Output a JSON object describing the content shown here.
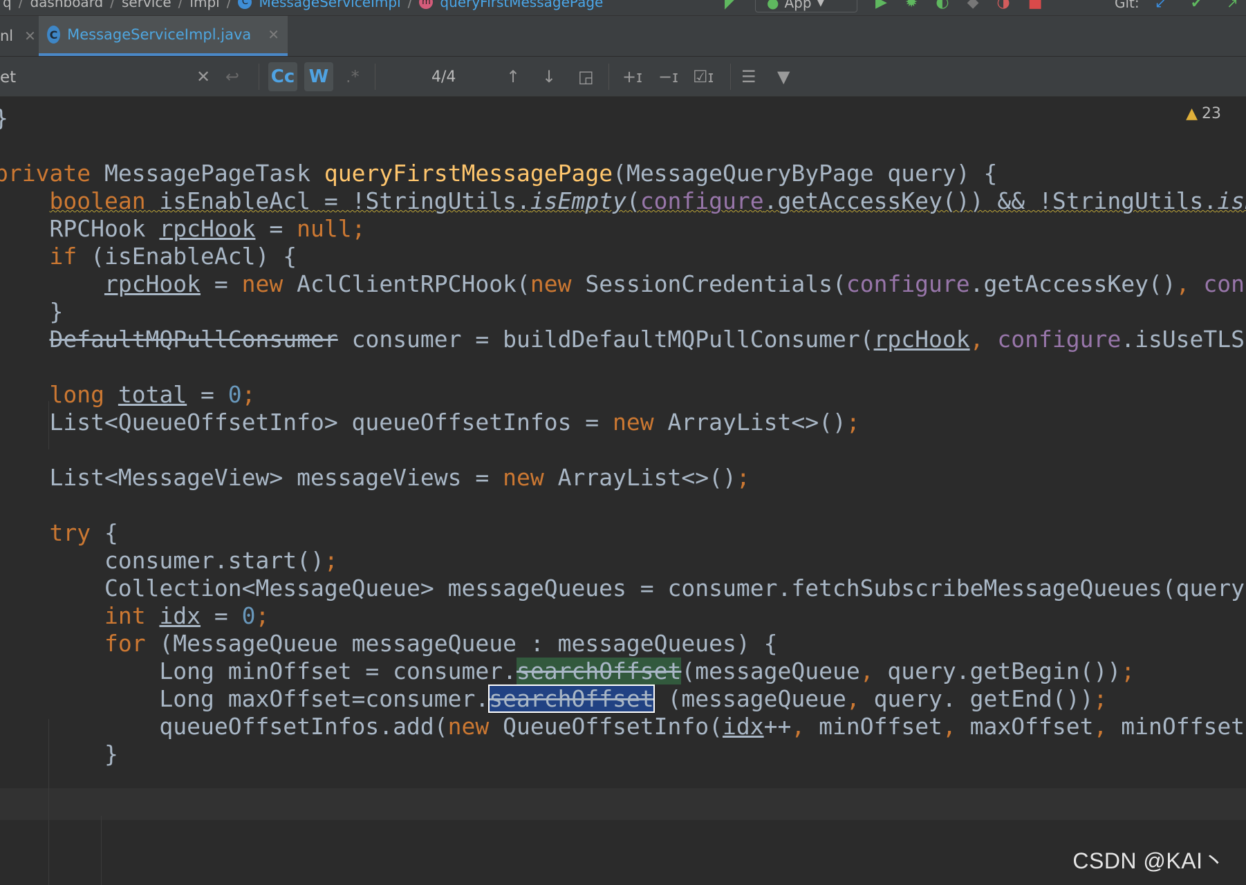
{
  "breadcrumb": {
    "items": [
      "q",
      "dashboard",
      "service",
      "impl"
    ],
    "class_name": "MessageServiceImpl",
    "method_name": "queryFirstMessagePage"
  },
  "toolbar": {
    "run_config": "App",
    "git_label": "Git:"
  },
  "tabs": [
    {
      "label": "nl"
    },
    {
      "label": "MessageServiceImpl.java",
      "icon": "C"
    }
  ],
  "search": {
    "value": "et",
    "match_case_label": "Cc",
    "words_label": "W",
    "regex_label": ".*",
    "match_count": "4/4"
  },
  "editor": {
    "warning_count": "23",
    "watermark": "CSDN @KAI丶",
    "colors": {
      "background": "#2b2b2b",
      "keyword": "#cc7832",
      "method": "#ffc66d",
      "field": "#9876aa",
      "number": "#6897bb",
      "text": "#a9b7c6",
      "search_current": "#214283",
      "search_match": "#32593d"
    },
    "lines": [
      [
        {
          "t": "}"
        }
      ],
      [],
      [
        {
          "t": "private",
          "c": "kw"
        },
        {
          "t": " MessagePageTask "
        },
        {
          "t": "queryFirstMessagePage",
          "c": "fn"
        },
        {
          "t": "(MessageQueryByPage query) {"
        }
      ],
      [
        {
          "t": "    "
        },
        {
          "t": "boolean",
          "c": "kw squig"
        },
        {
          "t": " isEnableAcl = !StringUtils.",
          "c": "squig"
        },
        {
          "t": "isEmpty",
          "c": "it squig"
        },
        {
          "t": "(",
          "c": "squig"
        },
        {
          "t": "configure",
          "c": "fld squig"
        },
        {
          "t": ".getAccessKey()) && !StringUtils.",
          "c": "squig"
        },
        {
          "t": "isEmp",
          "c": "it squig"
        }
      ],
      [
        {
          "t": "    RPCHook "
        },
        {
          "t": "rpcHook",
          "c": "u"
        },
        {
          "t": " = "
        },
        {
          "t": "null",
          "c": "kw"
        },
        {
          "t": ";",
          "c": "kw"
        }
      ],
      [
        {
          "t": "    "
        },
        {
          "t": "if",
          "c": "kw"
        },
        {
          "t": " (isEnableAcl) {"
        }
      ],
      [
        {
          "t": "        "
        },
        {
          "t": "rpcHook",
          "c": "u"
        },
        {
          "t": " = "
        },
        {
          "t": "new",
          "c": "kw"
        },
        {
          "t": " AclClientRPCHook("
        },
        {
          "t": "new",
          "c": "kw"
        },
        {
          "t": " SessionCredentials("
        },
        {
          "t": "configure",
          "c": "fld"
        },
        {
          "t": ".getAccessKey()"
        },
        {
          "t": ",",
          "c": "kw"
        },
        {
          "t": " "
        },
        {
          "t": "config",
          "c": "fld"
        }
      ],
      [
        {
          "t": "    }"
        }
      ],
      [
        {
          "t": "    "
        },
        {
          "t": "DefaultMQPullConsumer",
          "c": "strike"
        },
        {
          "t": " consumer = buildDefaultMQPullConsumer("
        },
        {
          "t": "rpcHook",
          "c": "u"
        },
        {
          "t": ",",
          "c": "kw"
        },
        {
          "t": " "
        },
        {
          "t": "configure",
          "c": "fld"
        },
        {
          "t": ".isUseTLS())"
        }
      ],
      [],
      [
        {
          "t": "    "
        },
        {
          "t": "long",
          "c": "kw"
        },
        {
          "t": " "
        },
        {
          "t": "total",
          "c": "u"
        },
        {
          "t": " = "
        },
        {
          "t": "0",
          "c": "num"
        },
        {
          "t": ";",
          "c": "kw"
        }
      ],
      [
        {
          "t": "    List<QueueOffsetInfo> queueOffsetInfos = "
        },
        {
          "t": "new",
          "c": "kw"
        },
        {
          "t": " ArrayList<>()"
        },
        {
          "t": ";",
          "c": "kw"
        }
      ],
      [],
      [
        {
          "t": "    List<MessageView> messageViews = "
        },
        {
          "t": "new",
          "c": "kw"
        },
        {
          "t": " ArrayList<>()"
        },
        {
          "t": ";",
          "c": "kw"
        }
      ],
      [],
      [
        {
          "t": "    "
        },
        {
          "t": "try",
          "c": "kw"
        },
        {
          "t": " {"
        }
      ],
      [
        {
          "t": "        consumer.start()"
        },
        {
          "t": ";",
          "c": "kw"
        }
      ],
      [
        {
          "t": "        Collection<MessageQueue> messageQueues = consumer.fetchSubscribeMessageQueues(query.ge"
        }
      ],
      [
        {
          "t": "        "
        },
        {
          "t": "int",
          "c": "kw"
        },
        {
          "t": " "
        },
        {
          "t": "idx",
          "c": "u"
        },
        {
          "t": " = "
        },
        {
          "t": "0",
          "c": "num"
        },
        {
          "t": ";",
          "c": "kw"
        }
      ],
      [
        {
          "t": "        "
        },
        {
          "t": "for",
          "c": "kw"
        },
        {
          "t": " (MessageQueue messageQueue : messageQueues) {"
        }
      ],
      [
        {
          "t": "            Long minOffset = consumer."
        },
        {
          "t": "searchOffset",
          "c": "hl-green"
        },
        {
          "t": "(messageQueue"
        },
        {
          "t": ",",
          "c": "kw"
        },
        {
          "t": " query.getBegin())"
        },
        {
          "t": ";",
          "c": "kw"
        }
      ],
      [
        {
          "t": "            Long maxOffset=consumer."
        },
        {
          "t": "searchOffset",
          "c": "hl-blue"
        },
        {
          "t": " (messageQueue"
        },
        {
          "t": ",",
          "c": "kw"
        },
        {
          "t": " query. getEnd())"
        },
        {
          "t": ";",
          "c": "kw"
        }
      ],
      [
        {
          "t": "            queueOffsetInfos.add("
        },
        {
          "t": "new",
          "c": "kw"
        },
        {
          "t": " QueueOffsetInfo("
        },
        {
          "t": "idx",
          "c": "u"
        },
        {
          "t": "++"
        },
        {
          "t": ",",
          "c": "kw"
        },
        {
          "t": " minOffset"
        },
        {
          "t": ",",
          "c": "kw"
        },
        {
          "t": " maxOffset"
        },
        {
          "t": ",",
          "c": "kw"
        },
        {
          "t": " minOffset"
        },
        {
          "t": ",",
          "c": "kw"
        },
        {
          "t": " m"
        }
      ],
      [
        {
          "t": "        }"
        }
      ]
    ]
  }
}
